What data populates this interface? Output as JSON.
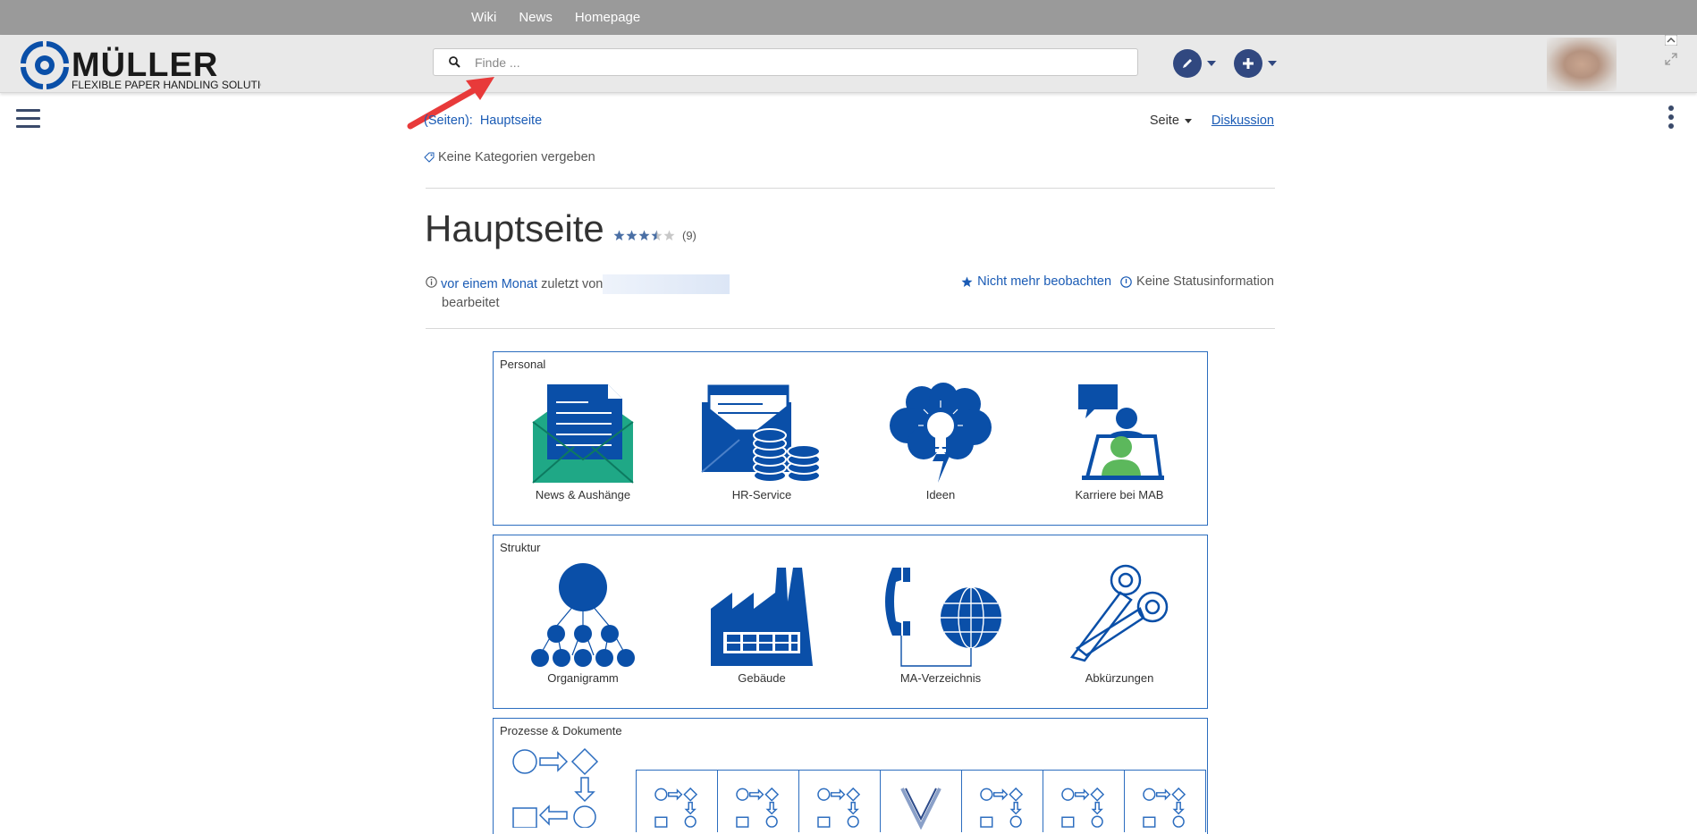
{
  "topnav": [
    "Wiki",
    "News",
    "Homepage"
  ],
  "logo": {
    "brand": "MÜLLER",
    "tagline": "FLEXIBLE PAPER HANDLING SOLUTIONS"
  },
  "search": {
    "placeholder": "Finde ...",
    "value": ""
  },
  "breadcrumb": {
    "root": "(Seiten):",
    "current": "Hauptseite"
  },
  "page_actions": {
    "page": "Seite",
    "discussion": "Diskussion"
  },
  "categories": "Keine Kategorien vergeben",
  "title": "Hauptseite",
  "rating": {
    "stars": 3.5,
    "max": 5,
    "count": "(9)"
  },
  "meta": {
    "time_link": "vor einem Monat",
    "edited_by": "zuletzt von",
    "edited": "bearbeitet",
    "watch": "Nicht mehr beobachten",
    "status": "Keine Statusinformation"
  },
  "sections": [
    {
      "title": "Personal",
      "tiles": [
        "News & Aushänge",
        "HR-Service",
        "Ideen",
        "Karriere bei MAB"
      ]
    },
    {
      "title": "Struktur",
      "tiles": [
        "Organigramm",
        "Gebäude",
        "MA-Verzeichnis",
        "Abkürzungen"
      ]
    },
    {
      "title": "Prozesse & Dokumente",
      "tiles": []
    }
  ],
  "colors": {
    "topbar": "#9a9a9a",
    "header": "#e9e9e9",
    "accent": "#1a5bb5",
    "icon_blue": "#0a4fa8",
    "teal": "#1fa886",
    "green": "#5cb85c"
  }
}
